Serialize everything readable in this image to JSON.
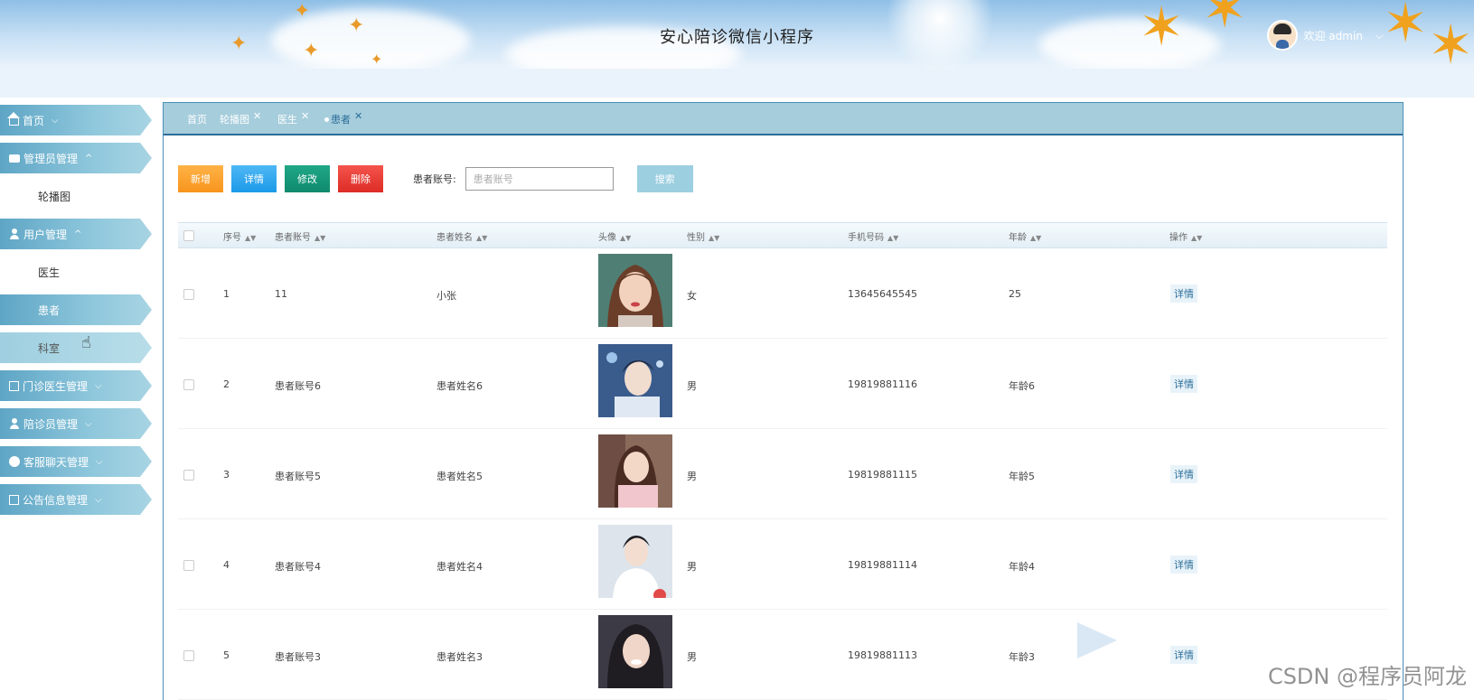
{
  "header": {
    "title": "安心陪诊微信小程序",
    "welcome": "欢迎 admin",
    "chevron": "⌵"
  },
  "sidebar": {
    "items": [
      {
        "label": "首页",
        "icon": "home-icon",
        "type": "parent",
        "chevron": "⌵"
      },
      {
        "label": "管理员管理",
        "icon": "box-icon",
        "type": "parent",
        "chevron": "^"
      },
      {
        "label": "轮播图",
        "type": "child"
      },
      {
        "label": "用户管理",
        "icon": "user-icon",
        "type": "parent",
        "chevron": "^"
      },
      {
        "label": "医生",
        "type": "child"
      },
      {
        "label": "患者",
        "type": "active-child"
      },
      {
        "label": "科室",
        "type": "hover-child"
      },
      {
        "label": "门诊医生管理",
        "icon": "grid-icon",
        "type": "parent",
        "chevron": "⌵"
      },
      {
        "label": "陪诊员管理",
        "icon": "user-icon",
        "type": "parent",
        "chevron": "⌵"
      },
      {
        "label": "客服聊天管理",
        "icon": "check-icon",
        "type": "parent",
        "chevron": "⌵"
      },
      {
        "label": "公告信息管理",
        "icon": "doc-icon",
        "type": "parent",
        "chevron": "⌵"
      }
    ]
  },
  "tabs": [
    {
      "label": "首页",
      "closable": false
    },
    {
      "label": "轮播图",
      "closable": true
    },
    {
      "label": "医生",
      "closable": true
    },
    {
      "label": "患者",
      "closable": true,
      "active": true
    }
  ],
  "toolbar": {
    "add_label": "新增",
    "detail_label": "详情",
    "edit_label": "修改",
    "delete_label": "删除",
    "search_label": "患者账号:",
    "search_placeholder": "患者账号",
    "search_button": "搜索"
  },
  "table": {
    "columns": [
      "序号",
      "患者账号",
      "患者姓名",
      "头像",
      "性别",
      "手机号码",
      "年龄",
      "操作"
    ],
    "rows": [
      {
        "index": "1",
        "account": "11",
        "name": "小张",
        "gender": "女",
        "phone": "13645645545",
        "age": "25",
        "action": "详情"
      },
      {
        "index": "2",
        "account": "患者账号6",
        "name": "患者姓名6",
        "gender": "男",
        "phone": "19819881116",
        "age": "年龄6",
        "action": "详情"
      },
      {
        "index": "3",
        "account": "患者账号5",
        "name": "患者姓名5",
        "gender": "男",
        "phone": "19819881115",
        "age": "年龄5",
        "action": "详情"
      },
      {
        "index": "4",
        "account": "患者账号4",
        "name": "患者姓名4",
        "gender": "男",
        "phone": "19819881114",
        "age": "年龄4",
        "action": "详情"
      },
      {
        "index": "5",
        "account": "患者账号3",
        "name": "患者姓名3",
        "gender": "男",
        "phone": "19819881113",
        "age": "年龄3",
        "action": "详情"
      }
    ]
  },
  "watermark": "CSDN @程序员阿龙",
  "colors": {
    "tab_bar": "#a6cddc",
    "sidebar_active": "#5ea5c5",
    "btn_add": "#f7941d",
    "btn_detail": "#1c9ae8",
    "btn_edit": "#0f8a6d",
    "btn_delete": "#dc2c25",
    "btn_search": "#9ccfe0"
  }
}
